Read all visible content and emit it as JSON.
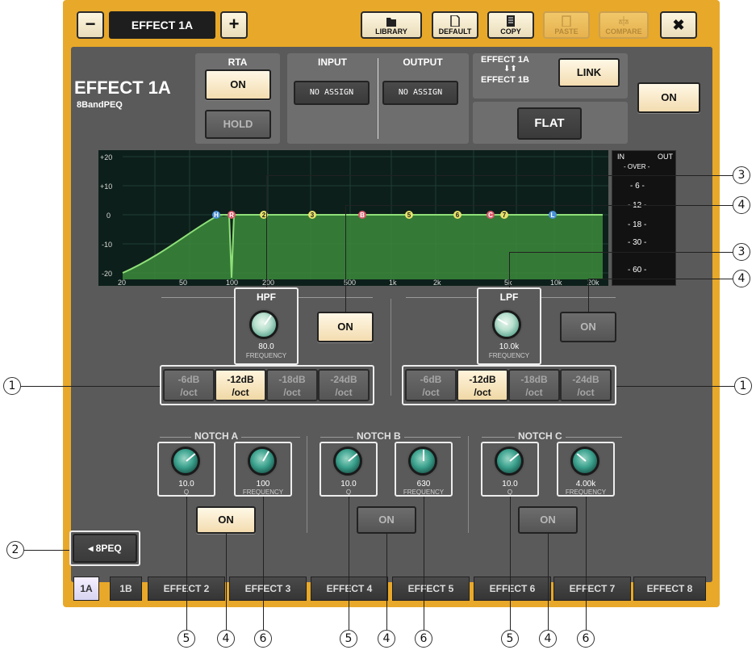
{
  "titlebar": {
    "minus": "−",
    "title": "EFFECT 1A",
    "plus": "+",
    "library": "LIBRARY",
    "default": "DEFAULT",
    "copy": "COPY",
    "paste": "PASTE",
    "compare": "COMPARE",
    "close": "✖"
  },
  "header": {
    "name": "EFFECT 1A",
    "type": "8BandPEQ",
    "rta_label": "RTA",
    "rta_on": "ON",
    "hold": "HOLD",
    "input_label": "INPUT",
    "output_label": "OUTPUT",
    "input_value": "NO ASSIGN",
    "output_value": "NO ASSIGN",
    "link_top": "EFFECT 1A",
    "link_arrows": "⬇⬆",
    "link_bottom": "EFFECT 1B",
    "link": "LINK",
    "flat": "FLAT",
    "main_on": "ON"
  },
  "graph": {
    "y_ticks": [
      "+20",
      "+10",
      "0",
      "-10",
      "-20"
    ],
    "x_ticks": [
      "20",
      "50",
      "100",
      "200",
      "500",
      "1k",
      "2k",
      "5k",
      "10k",
      "20k"
    ],
    "bands": [
      "H",
      "R",
      "2",
      "3",
      "B",
      "5",
      "6",
      "C",
      "7",
      "L"
    ]
  },
  "meter": {
    "in": "IN",
    "out": "OUT",
    "over": "- OVER -",
    "marks": [
      "- 6 -",
      "- 12 -",
      "- 18 -",
      "- 30 -",
      "- 60 -"
    ]
  },
  "hpf": {
    "label": "HPF",
    "value": "80.0",
    "param": "FREQUENCY",
    "on": "ON",
    "slopes": [
      {
        "db": "-6dB",
        "unit": "/oct"
      },
      {
        "db": "-12dB",
        "unit": "/oct"
      },
      {
        "db": "-18dB",
        "unit": "/oct"
      },
      {
        "db": "-24dB",
        "unit": "/oct"
      }
    ]
  },
  "lpf": {
    "label": "LPF",
    "value": "10.0k",
    "param": "FREQUENCY",
    "on": "ON",
    "slopes": [
      {
        "db": "-6dB",
        "unit": "/oct"
      },
      {
        "db": "-12dB",
        "unit": "/oct"
      },
      {
        "db": "-18dB",
        "unit": "/oct"
      },
      {
        "db": "-24dB",
        "unit": "/oct"
      }
    ]
  },
  "notch_a": {
    "label": "NOTCH A",
    "q": "10.0",
    "q_label": "Q",
    "freq": "100",
    "freq_label": "FREQUENCY",
    "on": "ON"
  },
  "notch_b": {
    "label": "NOTCH B",
    "q": "10.0",
    "q_label": "Q",
    "freq": "630",
    "freq_label": "FREQUENCY",
    "on": "ON"
  },
  "notch_c": {
    "label": "NOTCH C",
    "q": "10.0",
    "q_label": "Q",
    "freq": "4.00k",
    "freq_label": "FREQUENCY",
    "on": "ON"
  },
  "peq_button": "◂ 8PEQ",
  "tabs": [
    "1A",
    "1B",
    "EFFECT 2",
    "EFFECT 3",
    "EFFECT 4",
    "EFFECT 5",
    "EFFECT 6",
    "EFFECT 7",
    "EFFECT 8"
  ],
  "callouts": {
    "c1": "1",
    "c2": "2",
    "c3": "3",
    "c4": "4",
    "c5": "5",
    "c6": "6"
  }
}
